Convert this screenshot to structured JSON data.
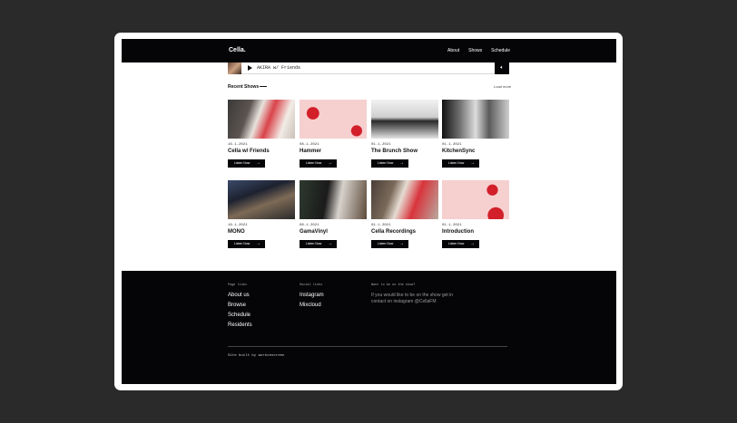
{
  "site": {
    "logo": "Cella."
  },
  "nav": {
    "items": [
      "About",
      "Shows",
      "Schedule"
    ]
  },
  "player": {
    "track": "AKIRA w/ Friends",
    "volume_icon": "speaker-icon"
  },
  "recent": {
    "heading": "Recent Shows",
    "more": "Load more"
  },
  "shows": [
    {
      "date": "16.1.2021",
      "title": "Cella w/ Friends",
      "button": "Listen Now",
      "arrow": "→"
    },
    {
      "date": "08.1.2021",
      "title": "Hammer",
      "button": "Listen Now",
      "arrow": "→"
    },
    {
      "date": "01.1.2021",
      "title": "The Brunch Show",
      "button": "Listen Now",
      "arrow": "→"
    },
    {
      "date": "01.1.2021",
      "title": "KitchenSync",
      "button": "Listen Now",
      "arrow": "→"
    },
    {
      "date": "16.1.2021",
      "title": "MONO",
      "button": "Listen Now",
      "arrow": "→"
    },
    {
      "date": "08.1.2021",
      "title": "GamaVinyl",
      "button": "Listen Now",
      "arrow": "→"
    },
    {
      "date": "01.1.2021",
      "title": "Cella Recordings",
      "button": "Listen Now",
      "arrow": "→"
    },
    {
      "date": "01.1.2021",
      "title": "Introduction",
      "button": "Listen Now",
      "arrow": "→"
    }
  ],
  "footer": {
    "col1": {
      "heading": "Page links",
      "links": [
        "About us",
        "Browse",
        "Schedule",
        "Residents"
      ]
    },
    "col2": {
      "heading": "Social links",
      "links": [
        "Instagram",
        "Mixcloud"
      ]
    },
    "col3": {
      "heading": "Want to be on the show?",
      "text": "If you would like to be on the show get in contact on instagram @CellaFM"
    },
    "credit": "Site built by workonscreen"
  },
  "colors": {
    "background": "#2a2a2a",
    "dark": "#050507",
    "accent": "#d21f2a"
  }
}
